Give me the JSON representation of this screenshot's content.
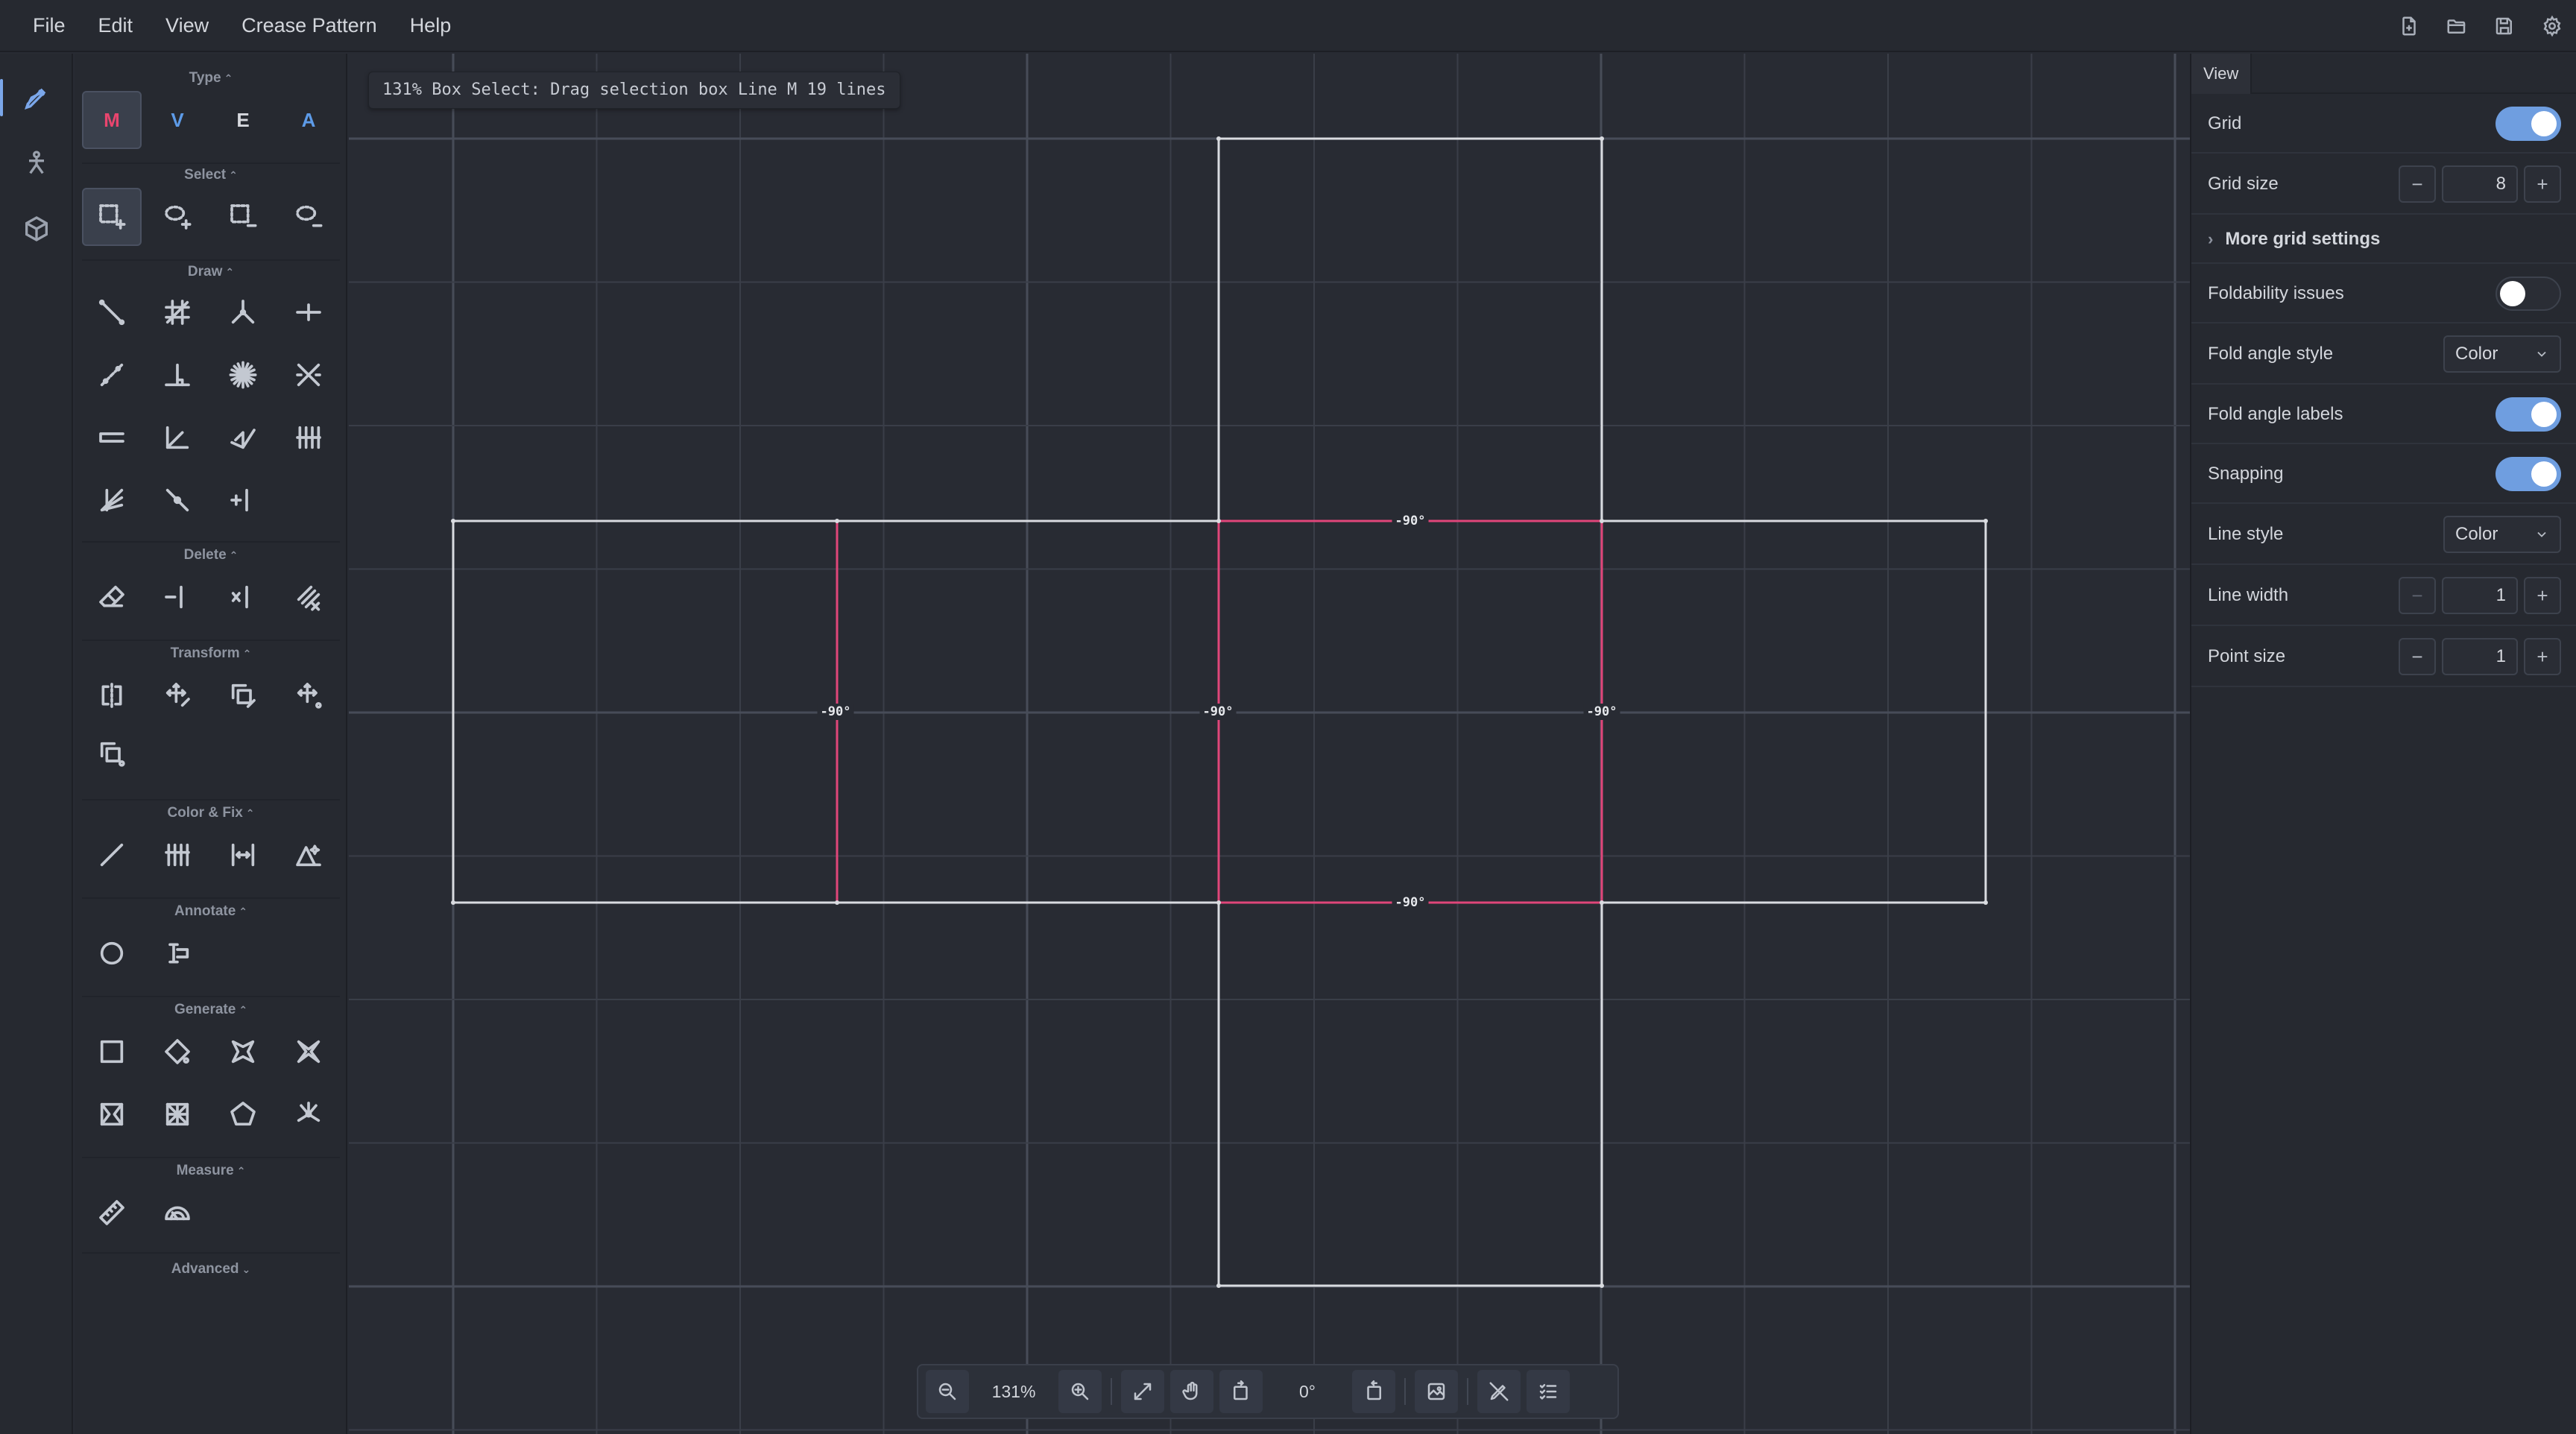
{
  "menu": [
    "File",
    "Edit",
    "View",
    "Crease Pattern",
    "Help"
  ],
  "header_icons": [
    "new-file-icon",
    "open-folder-icon",
    "save-icon",
    "settings-gear-icon"
  ],
  "rail": {
    "items": [
      "crease-pattern-pen-icon",
      "figure-person-icon",
      "3d-cube-icon"
    ]
  },
  "tools": {
    "type_title": "Type",
    "types": [
      {
        "label": "M",
        "color": "#e9456e"
      },
      {
        "label": "V",
        "color": "#5d9be8"
      },
      {
        "label": "E",
        "color": "#d6d8de"
      },
      {
        "label": "A",
        "color": "#5d9be8"
      }
    ],
    "select_title": "Select",
    "draw_title": "Draw",
    "delete_title": "Delete",
    "transform_title": "Transform",
    "color_title": "Color & Fix",
    "annotate_title": "Annotate",
    "generate_title": "Generate",
    "measure_title": "Measure",
    "advanced_title": "Advanced"
  },
  "status": {
    "text": "131% Box Select: Drag selection box Line M 19 lines"
  },
  "canvas": {
    "fold_labels": [
      "-90°",
      "-90°",
      "-90°",
      "-90°",
      "-90°"
    ],
    "colors": {
      "mountain": "#e0467a",
      "edge": "#d9dbe0",
      "grid": "#3a3e48",
      "grid_major": "#474c58"
    }
  },
  "bottom": {
    "zoom": "131%",
    "rotation": "0°"
  },
  "view_panel": {
    "tab": "View",
    "grid_label": "Grid",
    "grid_size_label": "Grid size",
    "grid_size": "8",
    "more_grid": "More grid settings",
    "foldability_label": "Foldability issues",
    "fold_angle_style_label": "Fold angle style",
    "fold_angle_style": "Color",
    "fold_angle_labels_label": "Fold angle labels",
    "snapping_label": "Snapping",
    "line_style_label": "Line style",
    "line_style": "Color",
    "line_width_label": "Line width",
    "line_width": "1",
    "point_size_label": "Point size",
    "point_size": "1",
    "toggles": {
      "grid": true,
      "foldability": false,
      "fold_angle_labels": true,
      "snapping": true
    }
  }
}
